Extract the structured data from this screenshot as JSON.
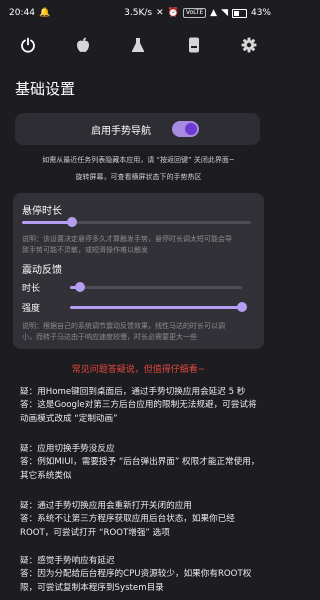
{
  "status_bar": {
    "time": "20:44",
    "speed": "3.5K/s",
    "volte": "VoLTE",
    "battery_percent": "43%"
  },
  "tabs": [
    {
      "icon": "power-icon",
      "active": true
    },
    {
      "icon": "apple-icon",
      "active": false
    },
    {
      "icon": "flask-icon",
      "active": false
    },
    {
      "icon": "phone-icon",
      "active": false
    },
    {
      "icon": "gear-icon",
      "active": false
    }
  ],
  "page_title": "基础设置",
  "gesture_nav": {
    "label": "启用手势导航",
    "enabled": true
  },
  "hints": {
    "line1": "如需从最近任务列表隐藏本应用，请 “按返回键” 关闭此界面~",
    "line2": "旋转屏幕，可查看横屏状态下的手势热区"
  },
  "hover_duration": {
    "title": "悬停时长",
    "value_fraction": 0.22,
    "description_line1": "说明：该设置决定悬停多久才算触发手势，悬停时长调太短可能会导",
    "description_line2": "致手势可能不灵敏，或短滑操作难以触发"
  },
  "vibration": {
    "title": "震动反馈",
    "duration_label": "时长",
    "duration_fraction": 0.06,
    "strength_label": "强度",
    "strength_fraction": 1.0,
    "description_line1": "说明：根据自己的系统调节震动反馈效果，线性马达的时长可以调",
    "description_line2": "小，而转子马达由于响应速度较慢，时长必需要更大一些"
  },
  "warning": "常见问题答疑说，但值得仔细看~",
  "faq": [
    {
      "q": "疑：用Home键回到桌面后，通过手势切换应用会延迟 5 秒",
      "a": "答：这是Google对第三方后台应用的限制无法规避，可尝试将动画模式改成 “定制动画”"
    },
    {
      "q": "疑：应用切换手势没反应",
      "a": "答：例如MIUI，需要授予 “后台弹出界面” 权限才能正常使用，其它系统类似"
    },
    {
      "q": "疑：通过手势切换应用会重新打开关闭的应用",
      "a": "答：系统不让第三方程序获取应用后台状态，如果你已经ROOT，可尝试打开 “ROOT增强” 选项"
    },
    {
      "q": "疑：感觉手势响应有延迟",
      "a": "答：因为分配给后台程序的CPU资源较少，如果你有ROOT权限，可尝试复制本程序到System目录"
    }
  ]
}
